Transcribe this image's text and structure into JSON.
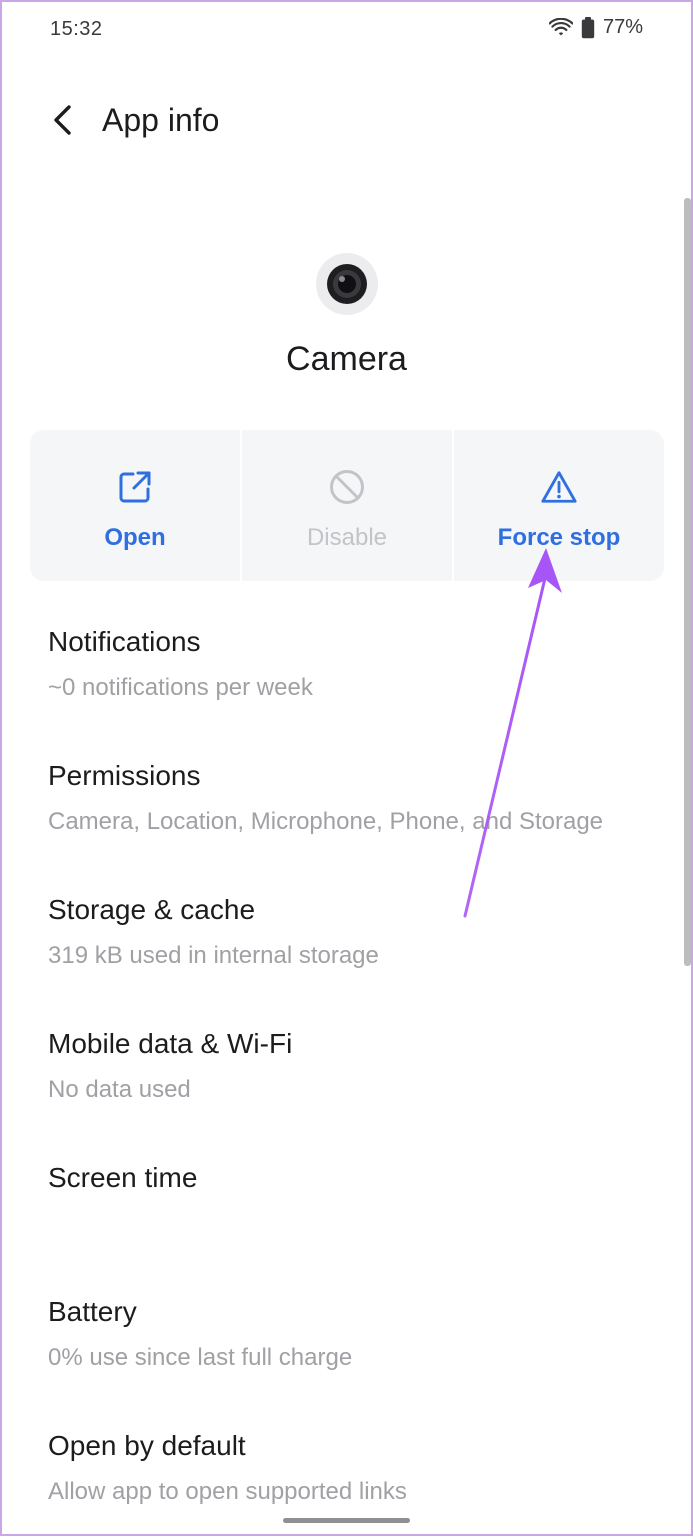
{
  "status_bar": {
    "time": "15:32",
    "battery_percent": "77%",
    "icons": [
      "wifi-icon",
      "battery-icon"
    ]
  },
  "header": {
    "back_icon": "chevron-left-icon",
    "title": "App info"
  },
  "app": {
    "icon": "camera-lens-icon",
    "name": "Camera"
  },
  "actions": [
    {
      "label": "Open",
      "icon": "open-external-icon",
      "enabled": true
    },
    {
      "label": "Disable",
      "icon": "disable-icon",
      "enabled": false
    },
    {
      "label": "Force stop",
      "icon": "warning-triangle-icon",
      "enabled": true
    }
  ],
  "settings": [
    {
      "title": "Notifications",
      "subtitle": "~0 notifications per week"
    },
    {
      "title": "Permissions",
      "subtitle": "Camera, Location, Microphone, Phone, and Storage"
    },
    {
      "title": "Storage & cache",
      "subtitle": "319 kB used in internal storage"
    },
    {
      "title": "Mobile data & Wi-Fi",
      "subtitle": "No data used"
    },
    {
      "title": "Screen time",
      "subtitle": ""
    },
    {
      "title": "Battery",
      "subtitle": "0% use since last full charge"
    },
    {
      "title": "Open by default",
      "subtitle": "Allow app to open supported links"
    }
  ],
  "colors": {
    "accent": "#2f6fe0",
    "disabled": "#c4c4c8",
    "annotation_arrow": "#a855f7",
    "card_background": "#f5f6f8"
  }
}
